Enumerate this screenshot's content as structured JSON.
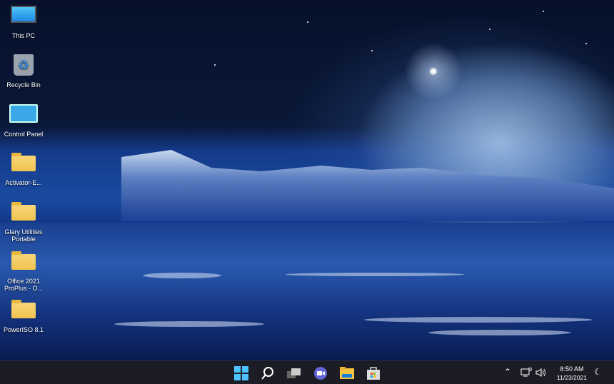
{
  "desktop_icons": [
    {
      "label": "This PC",
      "icon": "monitor-icon"
    },
    {
      "label": "Recycle Bin",
      "icon": "recycle-bin-icon"
    },
    {
      "label": "Control Panel",
      "icon": "control-panel-icon"
    },
    {
      "label": "Activator-E...",
      "icon": "folder-icon"
    },
    {
      "label": "Glary Utilities Portable",
      "icon": "folder-icon"
    },
    {
      "label": "Office 2021 ProPlus - O...",
      "icon": "folder-icon"
    },
    {
      "label": "PowerISO 8.1",
      "icon": "folder-icon"
    }
  ],
  "taskbar": {
    "apps": [
      "start-icon",
      "search-icon",
      "task-view-icon",
      "chat-icon",
      "file-explorer-icon",
      "store-icon"
    ]
  },
  "tray": {
    "time": "8:50 AM",
    "date": "11/23/2021"
  },
  "colors": {
    "taskbar": "#1c1c24",
    "folder": "#f0c34e"
  }
}
